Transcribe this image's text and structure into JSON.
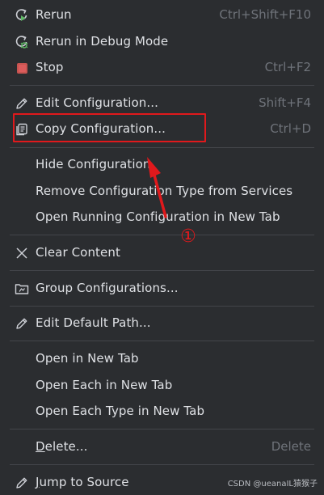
{
  "menu": {
    "rerun": {
      "label": "Rerun",
      "shortcut": "Ctrl+Shift+F10",
      "icon": "rerun-icon"
    },
    "rerun_debug": {
      "label": "Rerun in Debug Mode",
      "icon": "rerun-debug-icon"
    },
    "stop": {
      "label": "Stop",
      "shortcut": "Ctrl+F2",
      "icon": "stop-icon",
      "icon_color": "#c75450"
    },
    "edit_configuration": {
      "label": "Edit Configuration...",
      "shortcut": "Shift+F4",
      "icon": "pencil-icon"
    },
    "copy_configuration": {
      "label": "Copy Configuration...",
      "shortcut": "Ctrl+D",
      "icon": "copy-icon"
    },
    "hide_configuration": {
      "label": "Hide Configuration"
    },
    "remove_configuration_type": {
      "label": "Remove Configuration Type from Services"
    },
    "open_running_configuration": {
      "label": "Open Running Configuration in New Tab"
    },
    "clear_content": {
      "label": "Clear Content",
      "icon": "close-icon"
    },
    "group_configurations": {
      "label": "Group Configurations...",
      "icon": "folder-group-icon"
    },
    "edit_default_path": {
      "label": "Edit Default Path...",
      "icon": "pencil-icon"
    },
    "open_in_new_tab": {
      "label": "Open in New Tab"
    },
    "open_each_in_new_tab": {
      "label": "Open Each in New Tab"
    },
    "open_each_type_in_new_tab": {
      "label": "Open Each Type in New Tab"
    },
    "delete": {
      "label": "Delete...",
      "shortcut": "Delete"
    },
    "jump_to_source": {
      "label": "Jump to Source",
      "icon": "pencil-icon"
    }
  },
  "annotation": {
    "step_number": "①",
    "color": "#e0191c"
  },
  "watermark": {
    "text": "CSDN @ueanaIL猿猴子"
  },
  "colors": {
    "background": "#2b2d30",
    "text": "#dfe1e5",
    "shortcut": "#6f737a",
    "separator": "#43454a"
  }
}
